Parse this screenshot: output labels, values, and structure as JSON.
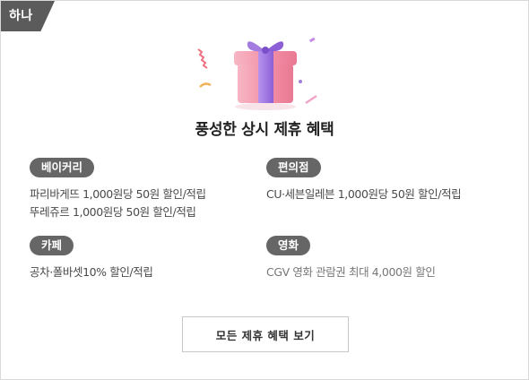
{
  "corner_tag": "하나",
  "title": "풍성한 상시 제휴 혜택",
  "benefits": [
    {
      "category": "베이커리",
      "lines": [
        "파리바게뜨 1,000원당 50원 할인/적립",
        "뚜레쥬르 1,000원당 50원 할인/적립"
      ]
    },
    {
      "category": "편의점",
      "lines": [
        "CU·세븐일레븐 1,000원당 50원 할인/적립"
      ]
    },
    {
      "category": "카페",
      "lines": [
        "공차·폴바셋10% 할인/적립"
      ]
    },
    {
      "category": "영화",
      "lines": [
        "CGV 영화 관람권 최대 4,000원 할인"
      ]
    }
  ],
  "view_all_button": "모든 제휴 혜택 보기",
  "colors": {
    "tag_bg": "#5b5b5b",
    "pill_bg": "#666666",
    "gift_box": "#f5a3b6",
    "gift_ribbon": "#a67be0"
  },
  "icons": {
    "illustration": "gift-box-icon"
  }
}
